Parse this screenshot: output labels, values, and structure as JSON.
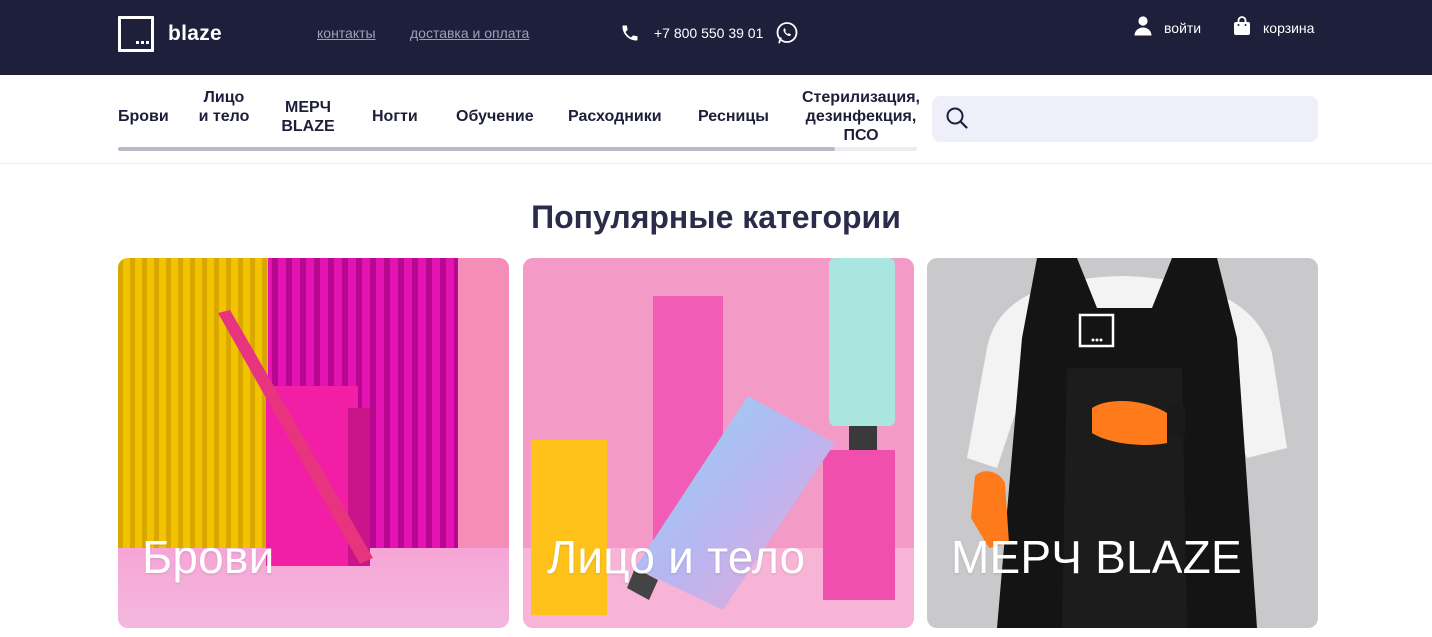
{
  "header": {
    "logo_text": "blaze",
    "links": [
      {
        "label": "контакты"
      },
      {
        "label": "доставка и оплата"
      }
    ],
    "phone": "+7 800 550 39 01",
    "login_label": "войти",
    "cart_label": "корзина"
  },
  "categories_nav": {
    "items": [
      {
        "label": "Брови"
      },
      {
        "label": "Лицо и тело"
      },
      {
        "label": "МЕРЧ BLAZE"
      },
      {
        "label": "Ногти"
      },
      {
        "label": "Обучение"
      },
      {
        "label": "Расходники"
      },
      {
        "label": "Ресницы"
      },
      {
        "label": "Стерилизация, дезинфекция, ПСО"
      }
    ],
    "search_placeholder": ""
  },
  "popular": {
    "title": "Популярные категории",
    "cards": [
      {
        "label": "Брови"
      },
      {
        "label": "Лицо и тело"
      },
      {
        "label": "МЕРЧ BLAZE"
      }
    ]
  },
  "colors": {
    "header_bg": "#1e1f3b",
    "search_bg": "#efeff9",
    "text_dark": "#1d1f3a",
    "link_muted": "#9ea0b7"
  },
  "icons": [
    "phone-icon",
    "whatsapp-icon",
    "user-icon",
    "cart-bag-icon",
    "search-icon"
  ]
}
